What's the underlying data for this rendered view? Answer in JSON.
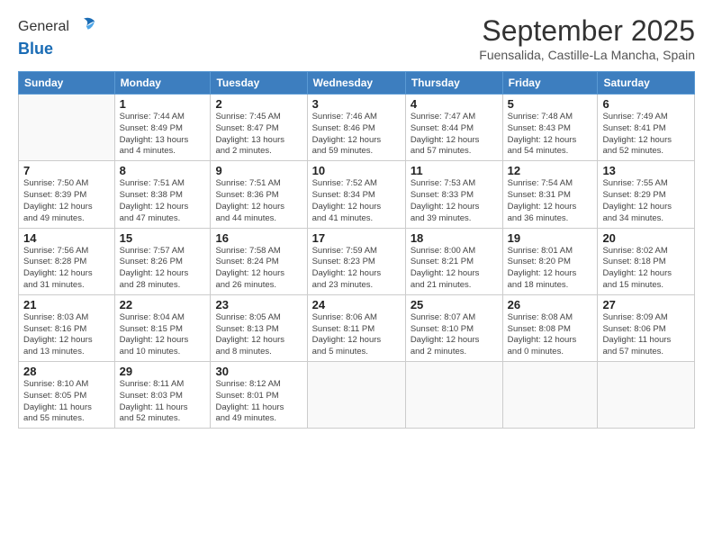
{
  "logo": {
    "general": "General",
    "blue": "Blue"
  },
  "title": "September 2025",
  "subtitle": "Fuensalida, Castille-La Mancha, Spain",
  "days_of_week": [
    "Sunday",
    "Monday",
    "Tuesday",
    "Wednesday",
    "Thursday",
    "Friday",
    "Saturday"
  ],
  "weeks": [
    [
      {
        "day": "",
        "info": ""
      },
      {
        "day": "1",
        "info": "Sunrise: 7:44 AM\nSunset: 8:49 PM\nDaylight: 13 hours\nand 4 minutes."
      },
      {
        "day": "2",
        "info": "Sunrise: 7:45 AM\nSunset: 8:47 PM\nDaylight: 13 hours\nand 2 minutes."
      },
      {
        "day": "3",
        "info": "Sunrise: 7:46 AM\nSunset: 8:46 PM\nDaylight: 12 hours\nand 59 minutes."
      },
      {
        "day": "4",
        "info": "Sunrise: 7:47 AM\nSunset: 8:44 PM\nDaylight: 12 hours\nand 57 minutes."
      },
      {
        "day": "5",
        "info": "Sunrise: 7:48 AM\nSunset: 8:43 PM\nDaylight: 12 hours\nand 54 minutes."
      },
      {
        "day": "6",
        "info": "Sunrise: 7:49 AM\nSunset: 8:41 PM\nDaylight: 12 hours\nand 52 minutes."
      }
    ],
    [
      {
        "day": "7",
        "info": "Sunrise: 7:50 AM\nSunset: 8:39 PM\nDaylight: 12 hours\nand 49 minutes."
      },
      {
        "day": "8",
        "info": "Sunrise: 7:51 AM\nSunset: 8:38 PM\nDaylight: 12 hours\nand 47 minutes."
      },
      {
        "day": "9",
        "info": "Sunrise: 7:51 AM\nSunset: 8:36 PM\nDaylight: 12 hours\nand 44 minutes."
      },
      {
        "day": "10",
        "info": "Sunrise: 7:52 AM\nSunset: 8:34 PM\nDaylight: 12 hours\nand 41 minutes."
      },
      {
        "day": "11",
        "info": "Sunrise: 7:53 AM\nSunset: 8:33 PM\nDaylight: 12 hours\nand 39 minutes."
      },
      {
        "day": "12",
        "info": "Sunrise: 7:54 AM\nSunset: 8:31 PM\nDaylight: 12 hours\nand 36 minutes."
      },
      {
        "day": "13",
        "info": "Sunrise: 7:55 AM\nSunset: 8:29 PM\nDaylight: 12 hours\nand 34 minutes."
      }
    ],
    [
      {
        "day": "14",
        "info": "Sunrise: 7:56 AM\nSunset: 8:28 PM\nDaylight: 12 hours\nand 31 minutes."
      },
      {
        "day": "15",
        "info": "Sunrise: 7:57 AM\nSunset: 8:26 PM\nDaylight: 12 hours\nand 28 minutes."
      },
      {
        "day": "16",
        "info": "Sunrise: 7:58 AM\nSunset: 8:24 PM\nDaylight: 12 hours\nand 26 minutes."
      },
      {
        "day": "17",
        "info": "Sunrise: 7:59 AM\nSunset: 8:23 PM\nDaylight: 12 hours\nand 23 minutes."
      },
      {
        "day": "18",
        "info": "Sunrise: 8:00 AM\nSunset: 8:21 PM\nDaylight: 12 hours\nand 21 minutes."
      },
      {
        "day": "19",
        "info": "Sunrise: 8:01 AM\nSunset: 8:20 PM\nDaylight: 12 hours\nand 18 minutes."
      },
      {
        "day": "20",
        "info": "Sunrise: 8:02 AM\nSunset: 8:18 PM\nDaylight: 12 hours\nand 15 minutes."
      }
    ],
    [
      {
        "day": "21",
        "info": "Sunrise: 8:03 AM\nSunset: 8:16 PM\nDaylight: 12 hours\nand 13 minutes."
      },
      {
        "day": "22",
        "info": "Sunrise: 8:04 AM\nSunset: 8:15 PM\nDaylight: 12 hours\nand 10 minutes."
      },
      {
        "day": "23",
        "info": "Sunrise: 8:05 AM\nSunset: 8:13 PM\nDaylight: 12 hours\nand 8 minutes."
      },
      {
        "day": "24",
        "info": "Sunrise: 8:06 AM\nSunset: 8:11 PM\nDaylight: 12 hours\nand 5 minutes."
      },
      {
        "day": "25",
        "info": "Sunrise: 8:07 AM\nSunset: 8:10 PM\nDaylight: 12 hours\nand 2 minutes."
      },
      {
        "day": "26",
        "info": "Sunrise: 8:08 AM\nSunset: 8:08 PM\nDaylight: 12 hours\nand 0 minutes."
      },
      {
        "day": "27",
        "info": "Sunrise: 8:09 AM\nSunset: 8:06 PM\nDaylight: 11 hours\nand 57 minutes."
      }
    ],
    [
      {
        "day": "28",
        "info": "Sunrise: 8:10 AM\nSunset: 8:05 PM\nDaylight: 11 hours\nand 55 minutes."
      },
      {
        "day": "29",
        "info": "Sunrise: 8:11 AM\nSunset: 8:03 PM\nDaylight: 11 hours\nand 52 minutes."
      },
      {
        "day": "30",
        "info": "Sunrise: 8:12 AM\nSunset: 8:01 PM\nDaylight: 11 hours\nand 49 minutes."
      },
      {
        "day": "",
        "info": ""
      },
      {
        "day": "",
        "info": ""
      },
      {
        "day": "",
        "info": ""
      },
      {
        "day": "",
        "info": ""
      }
    ]
  ]
}
